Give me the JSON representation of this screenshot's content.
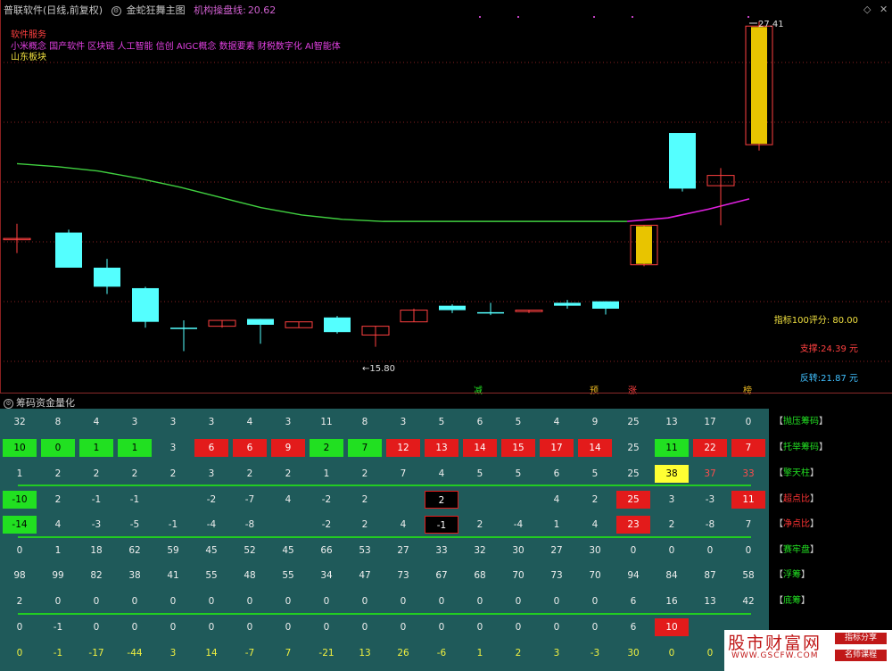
{
  "header": {
    "title": "普联软件(日线,前复权)",
    "indicator_name": "金蛇狂舞主图",
    "cost_line_label": "机构操盘线:",
    "cost_line_value": "20.62"
  },
  "sectors": {
    "line1": "软件服务",
    "line2": "小米概念 国产软件 区块链 人工智能 信创 AIGC概念 数据要素 财税数字化 AI智能体",
    "line3": "山东板块"
  },
  "window_controls": {
    "restore": "◇",
    "close": "✕"
  },
  "stats": {
    "score": "指标100评分: 80.00",
    "support": "支撑:24.39 元",
    "resistance": "反转:21.87 元"
  },
  "chart_data": {
    "type": "candlestick",
    "high_label": "27.41",
    "low_label": "←15.80",
    "candles": [
      {
        "o": 20.0,
        "c": 20.0,
        "h": 20.5,
        "l": 19.5,
        "color": "red"
      },
      {
        "o": 20.2,
        "c": 19.0,
        "h": 20.3,
        "l": 19.0,
        "color": "cyan"
      },
      {
        "o": 19.0,
        "c": 18.35,
        "h": 19.3,
        "l": 18.1,
        "color": "cyan"
      },
      {
        "o": 18.3,
        "c": 17.15,
        "h": 18.35,
        "l": 16.95,
        "color": "cyan"
      },
      {
        "o": 16.95,
        "c": 16.93,
        "h": 17.2,
        "l": 16.15,
        "color": "cyan"
      },
      {
        "o": 17.0,
        "c": 17.2,
        "h": 17.2,
        "l": 16.95,
        "color": "red"
      },
      {
        "o": 17.25,
        "c": 17.05,
        "h": 17.25,
        "l": 16.4,
        "color": "cyan"
      },
      {
        "o": 16.95,
        "c": 17.15,
        "h": 17.15,
        "l": 16.95,
        "color": "red"
      },
      {
        "o": 17.3,
        "c": 16.8,
        "h": 17.35,
        "l": 16.75,
        "color": "cyan"
      },
      {
        "o": 16.7,
        "c": 17.0,
        "h": 17.0,
        "l": 16.3,
        "color": "red"
      },
      {
        "o": 17.15,
        "c": 17.55,
        "h": 17.6,
        "l": 17.15,
        "color": "red"
      },
      {
        "o": 17.7,
        "c": 17.55,
        "h": 17.75,
        "l": 17.45,
        "color": "cyan"
      },
      {
        "o": 17.48,
        "c": 17.46,
        "h": 17.8,
        "l": 17.38,
        "color": "cyan"
      },
      {
        "o": 17.5,
        "c": 17.55,
        "h": 17.55,
        "l": 17.45,
        "color": "red"
      },
      {
        "o": 17.8,
        "c": 17.7,
        "h": 17.9,
        "l": 17.6,
        "color": "cyan"
      },
      {
        "o": 17.85,
        "c": 17.6,
        "h": 17.85,
        "l": 17.4,
        "color": "cyan"
      },
      {
        "o": 19.1,
        "c": 20.45,
        "h": 20.45,
        "l": 19.05,
        "color": "gold"
      },
      {
        "o": 23.6,
        "c": 21.7,
        "h": 23.6,
        "l": 21.6,
        "color": "cyan"
      },
      {
        "o": 21.8,
        "c": 22.15,
        "h": 22.4,
        "l": 20.45,
        "color": "red"
      },
      {
        "o": 23.2,
        "c": 27.25,
        "h": 27.41,
        "l": 23.0,
        "color": "gold"
      }
    ],
    "line": [
      22.55,
      22.5,
      22.47,
      22.42,
      22.35,
      22.25,
      22.1,
      21.92,
      21.72,
      21.5,
      21.3,
      21.08,
      20.9,
      20.75,
      20.65,
      20.6,
      20.58,
      20.58,
      20.58,
      20.58,
      20.58,
      20.58,
      20.58,
      20.58,
      20.58,
      20.58,
      20.58,
      20.58,
      20.58,
      20.58,
      20.58,
      20.58,
      20.58,
      20.58,
      20.58,
      20.58,
      20.58,
      20.58,
      20.58,
      20.58,
      20.58,
      20.58,
      20.58,
      20.58,
      20.58,
      20.58,
      20.58,
      20.58,
      20.58,
      20.58
    ],
    "line_series": [
      22.55,
      22.45,
      22.3,
      22.05,
      21.75,
      21.4,
      21.05,
      20.8,
      20.65,
      20.58,
      20.58,
      20.58,
      20.58,
      20.58,
      20.58,
      20.58,
      20.7,
      21.0,
      21.35
    ]
  },
  "markers": [
    {
      "text": "减",
      "col": 12,
      "color": "#22e022"
    },
    {
      "text": "预",
      "col": 15,
      "color": "#e0b020"
    },
    {
      "text": "涨",
      "col": 16,
      "color": "#ff4040"
    },
    {
      "text": "榜",
      "col": 19,
      "color": "#e0b020"
    }
  ],
  "panel": {
    "title": "筹码资金量化",
    "rows": [
      {
        "label": "抛压筹码",
        "lc": "g",
        "cells": [
          "32",
          "8",
          "4",
          "3",
          "3",
          "3",
          "4",
          "3",
          "11",
          "8",
          "3",
          "5",
          "6",
          "5",
          "4",
          "9",
          "25",
          "13",
          "17",
          "0"
        ],
        "styles": [
          "",
          "",
          "",
          "",
          "",
          "",
          "",
          "",
          "",
          "",
          "",
          "",
          "",
          "",
          "",
          "",
          "",
          "",
          "",
          ""
        ]
      },
      {
        "label": "托举筹码",
        "lc": "g",
        "cells": [
          "10",
          "0",
          "1",
          "1",
          "3",
          "6",
          "6",
          "9",
          "2",
          "7",
          "12",
          "13",
          "14",
          "15",
          "17",
          "14",
          "25",
          "11",
          "22",
          "7"
        ],
        "styles": [
          "green",
          "green",
          "green",
          "green",
          "",
          "red",
          "red",
          "red",
          "green",
          "green",
          "red",
          "red",
          "red",
          "red",
          "red",
          "red",
          "",
          "green",
          "red",
          "red"
        ]
      },
      {
        "label": "擎天柱",
        "lc": "g",
        "cells": [
          "1",
          "2",
          "2",
          "2",
          "2",
          "3",
          "2",
          "2",
          "1",
          "2",
          "7",
          "4",
          "5",
          "5",
          "6",
          "5",
          "25",
          "38",
          "37",
          "33"
        ],
        "styles": [
          "",
          "",
          "",
          "",
          "",
          "",
          "",
          "",
          "",
          "",
          "",
          "",
          "",
          "",
          "",
          "",
          "",
          "yellow",
          "txt-red",
          "txt-red"
        ]
      },
      {
        "label": "超点比",
        "lc": "r",
        "cells": [
          "-10",
          "2",
          "-1",
          "-1",
          "",
          "-2",
          "-7",
          "4",
          "-2",
          "2",
          "",
          "2",
          "",
          "",
          "4",
          "2",
          "25",
          "3",
          "-3",
          "11"
        ],
        "styles": [
          "green",
          "",
          "",
          "",
          "",
          "",
          "",
          "",
          "",
          "",
          "",
          "black",
          "",
          "",
          "",
          "",
          "red",
          "",
          "",
          "red"
        ]
      },
      {
        "label": "净点比",
        "lc": "r",
        "cells": [
          "-14",
          "4",
          "-3",
          "-5",
          "-1",
          "-4",
          "-8",
          "",
          "-2",
          "2",
          "4",
          "-1",
          "2",
          "-4",
          "1",
          "4",
          "23",
          "2",
          "-8",
          "7"
        ],
        "styles": [
          "green",
          "",
          "",
          "",
          "",
          "",
          "",
          "",
          "",
          "",
          "",
          "black",
          "",
          "",
          "",
          "",
          "red",
          "",
          "",
          ""
        ]
      },
      {
        "label": "赛牢盘",
        "lc": "g",
        "cells": [
          "0",
          "1",
          "18",
          "62",
          "59",
          "45",
          "52",
          "45",
          "66",
          "53",
          "27",
          "33",
          "32",
          "30",
          "27",
          "30",
          "0",
          "0",
          "0",
          "0"
        ],
        "styles": [
          "",
          "",
          "",
          "",
          "",
          "",
          "",
          "",
          "",
          "",
          "",
          "",
          "",
          "",
          "",
          "",
          "",
          "",
          "",
          ""
        ]
      },
      {
        "label": "浮筹",
        "lc": "g",
        "cells": [
          "98",
          "99",
          "82",
          "38",
          "41",
          "55",
          "48",
          "55",
          "34",
          "47",
          "73",
          "67",
          "68",
          "70",
          "73",
          "70",
          "94",
          "84",
          "87",
          "58"
        ],
        "styles": [
          "",
          "",
          "",
          "",
          "",
          "",
          "",
          "",
          "",
          "",
          "",
          "",
          "",
          "",
          "",
          "",
          "",
          "",
          "",
          ""
        ]
      },
      {
        "label": "底筹",
        "lc": "g",
        "cells": [
          "2",
          "0",
          "0",
          "0",
          "0",
          "0",
          "0",
          "0",
          "0",
          "0",
          "0",
          "0",
          "0",
          "0",
          "0",
          "0",
          "6",
          "16",
          "13",
          "42"
        ],
        "styles": [
          "",
          "",
          "",
          "",
          "",
          "",
          "",
          "",
          "",
          "",
          "",
          "",
          "",
          "",
          "",
          "",
          "",
          "",
          "",
          ""
        ]
      },
      {
        "label": "",
        "lc": "g",
        "cells": [
          "0",
          "-1",
          "0",
          "0",
          "0",
          "0",
          "0",
          "0",
          "0",
          "0",
          "0",
          "0",
          "0",
          "0",
          "0",
          "0",
          "6",
          "10",
          "",
          ""
        ],
        "styles": [
          "",
          "",
          "",
          "",
          "",
          "",
          "",
          "",
          "",
          "",
          "",
          "",
          "",
          "",
          "",
          "",
          "",
          "red",
          "",
          ""
        ]
      },
      {
        "label": "",
        "lc": "g",
        "cells": [
          "0",
          "-1",
          "-17",
          "-44",
          "3",
          "14",
          "-7",
          "7",
          "-21",
          "13",
          "26",
          "-6",
          "1",
          "2",
          "3",
          "-3",
          "30",
          "0",
          "0",
          ""
        ],
        "styles": [
          "txt-yellow",
          "txt-yellow",
          "txt-yellow",
          "txt-yellow",
          "txt-yellow",
          "txt-yellow",
          "txt-yellow",
          "txt-yellow",
          "txt-yellow",
          "txt-yellow",
          "txt-yellow",
          "txt-yellow",
          "txt-yellow",
          "txt-yellow",
          "txt-yellow",
          "txt-yellow",
          "txt-yellow",
          "txt-yellow",
          "txt-yellow",
          ""
        ]
      }
    ]
  },
  "watermark": {
    "site": "股市财富网",
    "url": "WWW.GSCFW.COM",
    "tag1": "指标分享",
    "tag2": "名师课程"
  }
}
